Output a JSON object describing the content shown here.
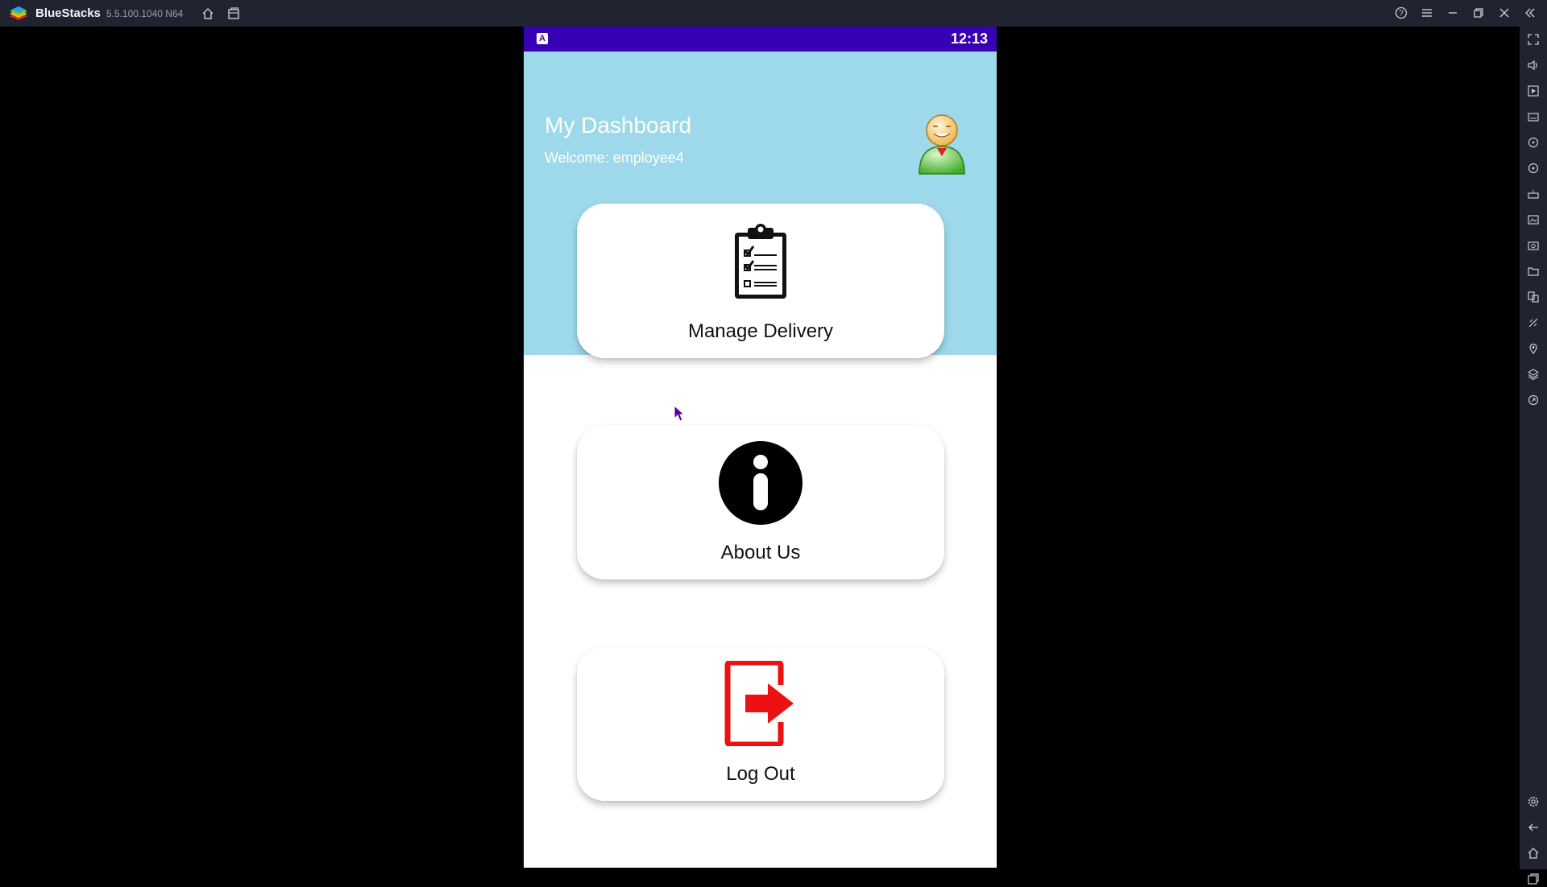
{
  "window": {
    "app_name": "BlueStacks",
    "version": "5.5.100.1040 N64"
  },
  "titlebar_icons": [
    "home-icon",
    "multi-instance-icon",
    "help-icon",
    "menu-icon",
    "minimize-icon",
    "restore-icon",
    "close-icon",
    "collapse-sidebar-icon"
  ],
  "sidebar_icons": [
    "fullscreen-icon",
    "volume-icon",
    "screen-recorder-icon",
    "keyboard-controls-icon",
    "macro-icon",
    "sync-icon",
    "gamepad-icon",
    "media-manager-icon",
    "screenshot-icon",
    "folder-icon",
    "multi-instance-manager-icon",
    "eco-mode-icon",
    "location-icon",
    "layers-icon",
    "rotate-icon",
    "settings-icon",
    "back-icon",
    "home-icon",
    "recent-apps-icon"
  ],
  "status_bar": {
    "notification_icon": "A",
    "time": "12:13",
    "color": "#3700b3"
  },
  "header": {
    "title": "My Dashboard",
    "welcome": "Welcome: employee4",
    "color": "#9dd9eb"
  },
  "cards": [
    {
      "label": "Manage Delivery",
      "icon": "clipboard-checklist-icon"
    },
    {
      "label": "About Us",
      "icon": "info-icon"
    },
    {
      "label": "Log Out",
      "icon": "logout-icon",
      "accent": "#ee1111"
    }
  ]
}
